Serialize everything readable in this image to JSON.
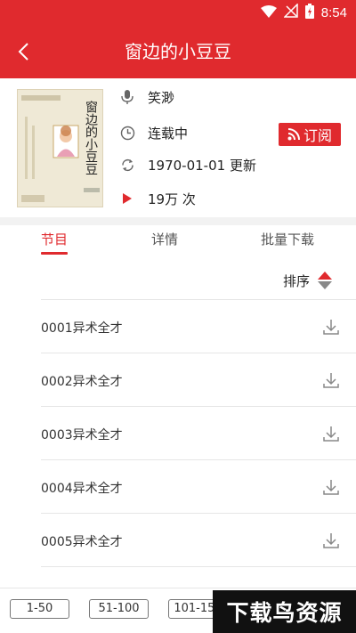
{
  "status_bar": {
    "time": "8:54",
    "icons": [
      "wifi-icon",
      "no-signal-icon",
      "battery-charging-icon"
    ]
  },
  "header": {
    "title": "窗边的小豆豆",
    "back_icon": "chevron-left-icon"
  },
  "book": {
    "cover_title": "窗边的小豆豆",
    "author": "笑渺",
    "status": "连载中",
    "updated": "1970-01-01 更新",
    "plays": "19万 次"
  },
  "subscribe_label": "订阅",
  "tabs": [
    {
      "label": "节目",
      "active": true
    },
    {
      "label": "详情",
      "active": false
    },
    {
      "label": "批量下载",
      "active": false
    }
  ],
  "sort_label": "排序",
  "episodes": [
    {
      "title": "0001异术全才"
    },
    {
      "title": "0002异术全才"
    },
    {
      "title": "0003异术全才"
    },
    {
      "title": "0004异术全才"
    },
    {
      "title": "0005异术全才"
    }
  ],
  "ranges": [
    "1-50",
    "51-100",
    "101-150"
  ],
  "watermark": "下载鸟资源",
  "colors": {
    "accent": "#e02a2e",
    "divider": "#e6e6e6"
  }
}
